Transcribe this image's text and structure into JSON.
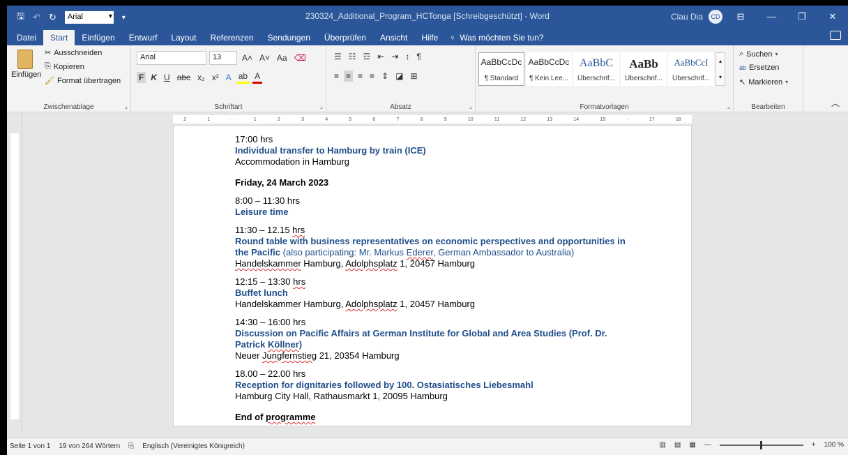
{
  "titlebar": {
    "font_name": "Arial",
    "title": "230324_Additional_Program_HCTonga [Schreibgeschützt] - Word",
    "user_name": "Clau Dia",
    "user_initials": "CD"
  },
  "menu": {
    "tabs": [
      "Datei",
      "Start",
      "Einfügen",
      "Entwurf",
      "Layout",
      "Referenzen",
      "Sendungen",
      "Überprüfen",
      "Ansicht",
      "Hilfe"
    ],
    "active_tab": "Start",
    "tell_me": "Was möchten Sie tun?"
  },
  "ribbon": {
    "clipboard": {
      "paste": "Einfügen",
      "cut": "Ausschneiden",
      "copy": "Kopieren",
      "format_painter": "Format übertragen",
      "label": "Zwischenablage"
    },
    "font": {
      "name": "Arial",
      "size": "13",
      "label": "Schriftart"
    },
    "paragraph": {
      "label": "Absatz"
    },
    "styles": {
      "items": [
        {
          "preview": "AaBbCcDc",
          "name": "¶ Standard"
        },
        {
          "preview": "AaBbCcDc",
          "name": "¶ Kein Lee..."
        },
        {
          "preview": "AaBbC",
          "name": "Überschrif..."
        },
        {
          "preview": "AaBb",
          "name": "Überschrif..."
        },
        {
          "preview": "AaBbCcI",
          "name": "Überschrif..."
        }
      ],
      "label": "Formatvorlagen"
    },
    "editing": {
      "search": "Suchen",
      "replace": "Ersetzen",
      "select": "Markieren",
      "label": "Bearbeiten"
    }
  },
  "document": {
    "block1": {
      "time": "17:00 hrs",
      "title": "Individual transfer to Hamburg by train (ICE)",
      "place": "Accommodation in Hamburg"
    },
    "day_heading": "Friday, 24 March 2023",
    "block2": {
      "time": "8:00 – 11:30 hrs",
      "title": "Leisure time"
    },
    "block3": {
      "time_a": "11:30 – 12.15 ",
      "time_b": "hrs",
      "title_a": "Round table with business representatives on economic perspectives and opportunities in",
      "title_b": "the Pacific",
      "note_a": " (also participating: Mr. Markus ",
      "note_b": "Ederer",
      "note_c": ", German Ambassador to Australia)",
      "place_a": "Handelskammer",
      "place_b": " Hamburg, ",
      "place_c": "Adolphsplatz",
      "place_d": " 1, 20457 Hamburg"
    },
    "block4": {
      "time_a": "12:15 – 13:30 ",
      "time_b": "hrs",
      "title": "Buffet lunch",
      "place_a": "Handelskammer Hamburg, ",
      "place_b": "Adolphsplatz",
      "place_c": " 1, 20457 Hamburg"
    },
    "block5": {
      "time": "14:30 – 16:00 hrs",
      "title_a": "Discussion on Pacific Affairs at German Institute for Global and Area Studies (Prof. Dr.",
      "title_b": "Patrick ",
      "title_c": "Köllner",
      "title_d": ")",
      "place_a": "Neuer ",
      "place_b": "Jungfernstieg",
      "place_c": " 21, 20354 Hamburg"
    },
    "block6": {
      "time": "18.00 – 22.00 hrs",
      "title": "Reception for dignitaries followed by 100. Ostasiatisches Liebesmahl",
      "place": "Hamburg City Hall, Rathausmarkt 1, 20095 Hamburg"
    },
    "end_a": "End of ",
    "end_b": "programme"
  },
  "status": {
    "page": "Seite 1 von 1",
    "words": "19 von 264 Wörtern",
    "language": "Englisch (Vereinigtes Königreich)",
    "zoom": "100 %"
  }
}
